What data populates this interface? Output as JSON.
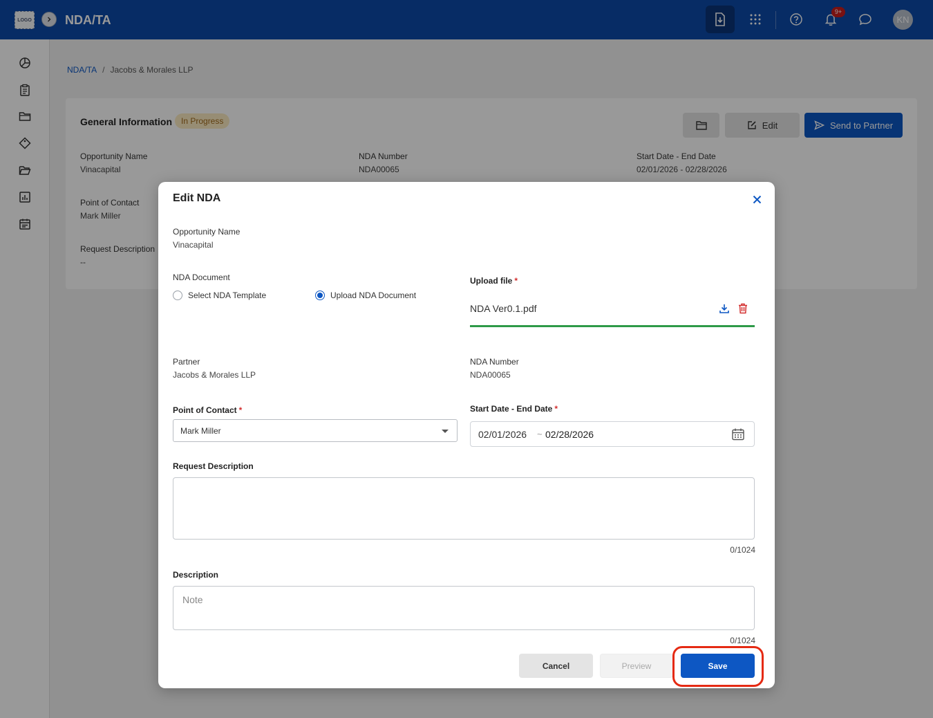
{
  "header": {
    "logo_text": "LOGO",
    "app_title": "NDA/TA",
    "notification_badge": "9+",
    "avatar_initials": "KN",
    "icons": [
      "expand-icon",
      "download-doc-icon",
      "apps-grid-icon",
      "help-icon",
      "bell-icon",
      "chat-icon"
    ]
  },
  "sidebar": {
    "icons": [
      "dashboard-icon",
      "clipboard-icon",
      "folder-icon",
      "tag-icon",
      "folder-open-icon",
      "report-icon",
      "calendar-icon"
    ]
  },
  "breadcrumb": {
    "root": "NDA/TA",
    "separator": "/",
    "current": "Jacobs & Morales LLP"
  },
  "card": {
    "title": "General Information",
    "status": "In Progress",
    "edit_label": "Edit",
    "send_label": "Send to Partner",
    "fields": {
      "opportunity_label": "Opportunity Name",
      "opportunity_value": "Vinacapital",
      "nda_number_label": "NDA Number",
      "nda_number_value": "NDA00065",
      "date_label": "Start Date - End Date",
      "date_value": "02/01/2026 - 02/28/2026",
      "contact_label": "Point of Contact",
      "contact_value": "Mark Miller",
      "request_label": "Request Description",
      "request_value": "--"
    }
  },
  "modal": {
    "title": "Edit NDA",
    "opportunity_label": "Opportunity Name",
    "opportunity_value": "Vinacapital",
    "nda_document_label": "NDA Document",
    "radio_template": "Select NDA Template",
    "radio_upload": "Upload NDA Document",
    "radio_selected": "Upload NDA Document",
    "upload_label": "Upload file",
    "required_mark": "*",
    "file_name": "NDA Ver0.1.pdf",
    "partner_label": "Partner",
    "partner_value": "Jacobs & Morales LLP",
    "nda_number_label": "NDA Number",
    "nda_number_value": "NDA00065",
    "contact_label": "Point of Contact",
    "contact_value": "Mark  Miller",
    "date_label": "Start Date - End Date",
    "start_date": "02/01/2026",
    "date_separator": "~",
    "end_date": "02/28/2026",
    "request_label": "Request Description",
    "request_counter": "0/1024",
    "description_label": "Description",
    "description_placeholder": "Note",
    "description_counter": "0/1024",
    "cancel_label": "Cancel",
    "preview_label": "Preview",
    "save_label": "Save"
  },
  "colors": {
    "brand": "#0d4aa8",
    "primary_button": "#0d57c3",
    "upload_success": "#2e9a48",
    "delete": "#d32f2f",
    "highlight": "#e52a13",
    "status_badge_bg": "#fcecc2"
  }
}
